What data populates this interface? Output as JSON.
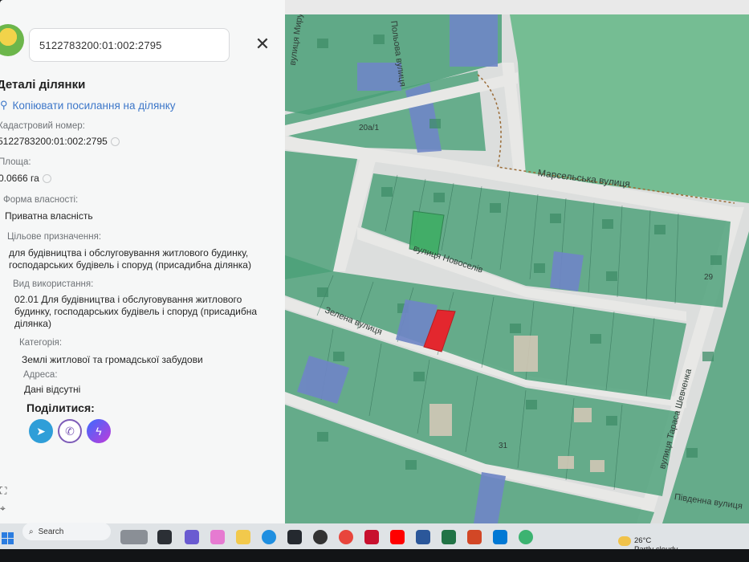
{
  "panel": {
    "search_value": "5122783200:01:002:2795",
    "title": "Деталі ділянки",
    "copy_link": "Копіювати посилання на ділянку",
    "fields": [
      {
        "label": "Кадастровий номер:",
        "value": "5122783200:01:002:2795"
      },
      {
        "label": "Площа:",
        "value": "0.0666 га"
      },
      {
        "label": "Форма власності:",
        "value": "Приватна власність"
      },
      {
        "label": "Цільове призначення:",
        "value": "для будівництва і обслуговування житлового будинку, господарських будівель і споруд (присадибна ділянка)"
      },
      {
        "label": "Вид використання:",
        "value": "02.01 Для будівництва і обслуговування житлового будинку, господарських будівель і споруд (присадибна ділянка)"
      },
      {
        "label": "Категорія:",
        "value": "Землі житлової та громадської забудови"
      },
      {
        "label": "Адреса:",
        "value": "Дані відсутні"
      }
    ],
    "share_title": "Поділитися:",
    "share_buttons": [
      "telegram-icon",
      "viber-icon",
      "messenger-icon"
    ]
  },
  "map": {
    "streets": [
      {
        "name": "вулиця Миру"
      },
      {
        "name": "Польова вулиця"
      },
      {
        "name": "Марсельська вулиця"
      },
      {
        "name": "вулиця Новоселів"
      },
      {
        "name": "Зелена вулиця"
      },
      {
        "name": "вулиця Тараса Шевченка"
      },
      {
        "name": "Південна вулиця"
      }
    ],
    "house_numbers": [
      "20а/1",
      "29",
      "31"
    ],
    "colors": {
      "parcel_green": "#4aa078",
      "parcel_blue": "#6f86c6",
      "selected_parcel": "#e3272e",
      "road": "#e6e6e4",
      "forest": "#69b98b"
    }
  },
  "taskbar": {
    "search_label": "Search",
    "weather_temp": "26°C",
    "weather_desc": "Partly cloudy"
  }
}
